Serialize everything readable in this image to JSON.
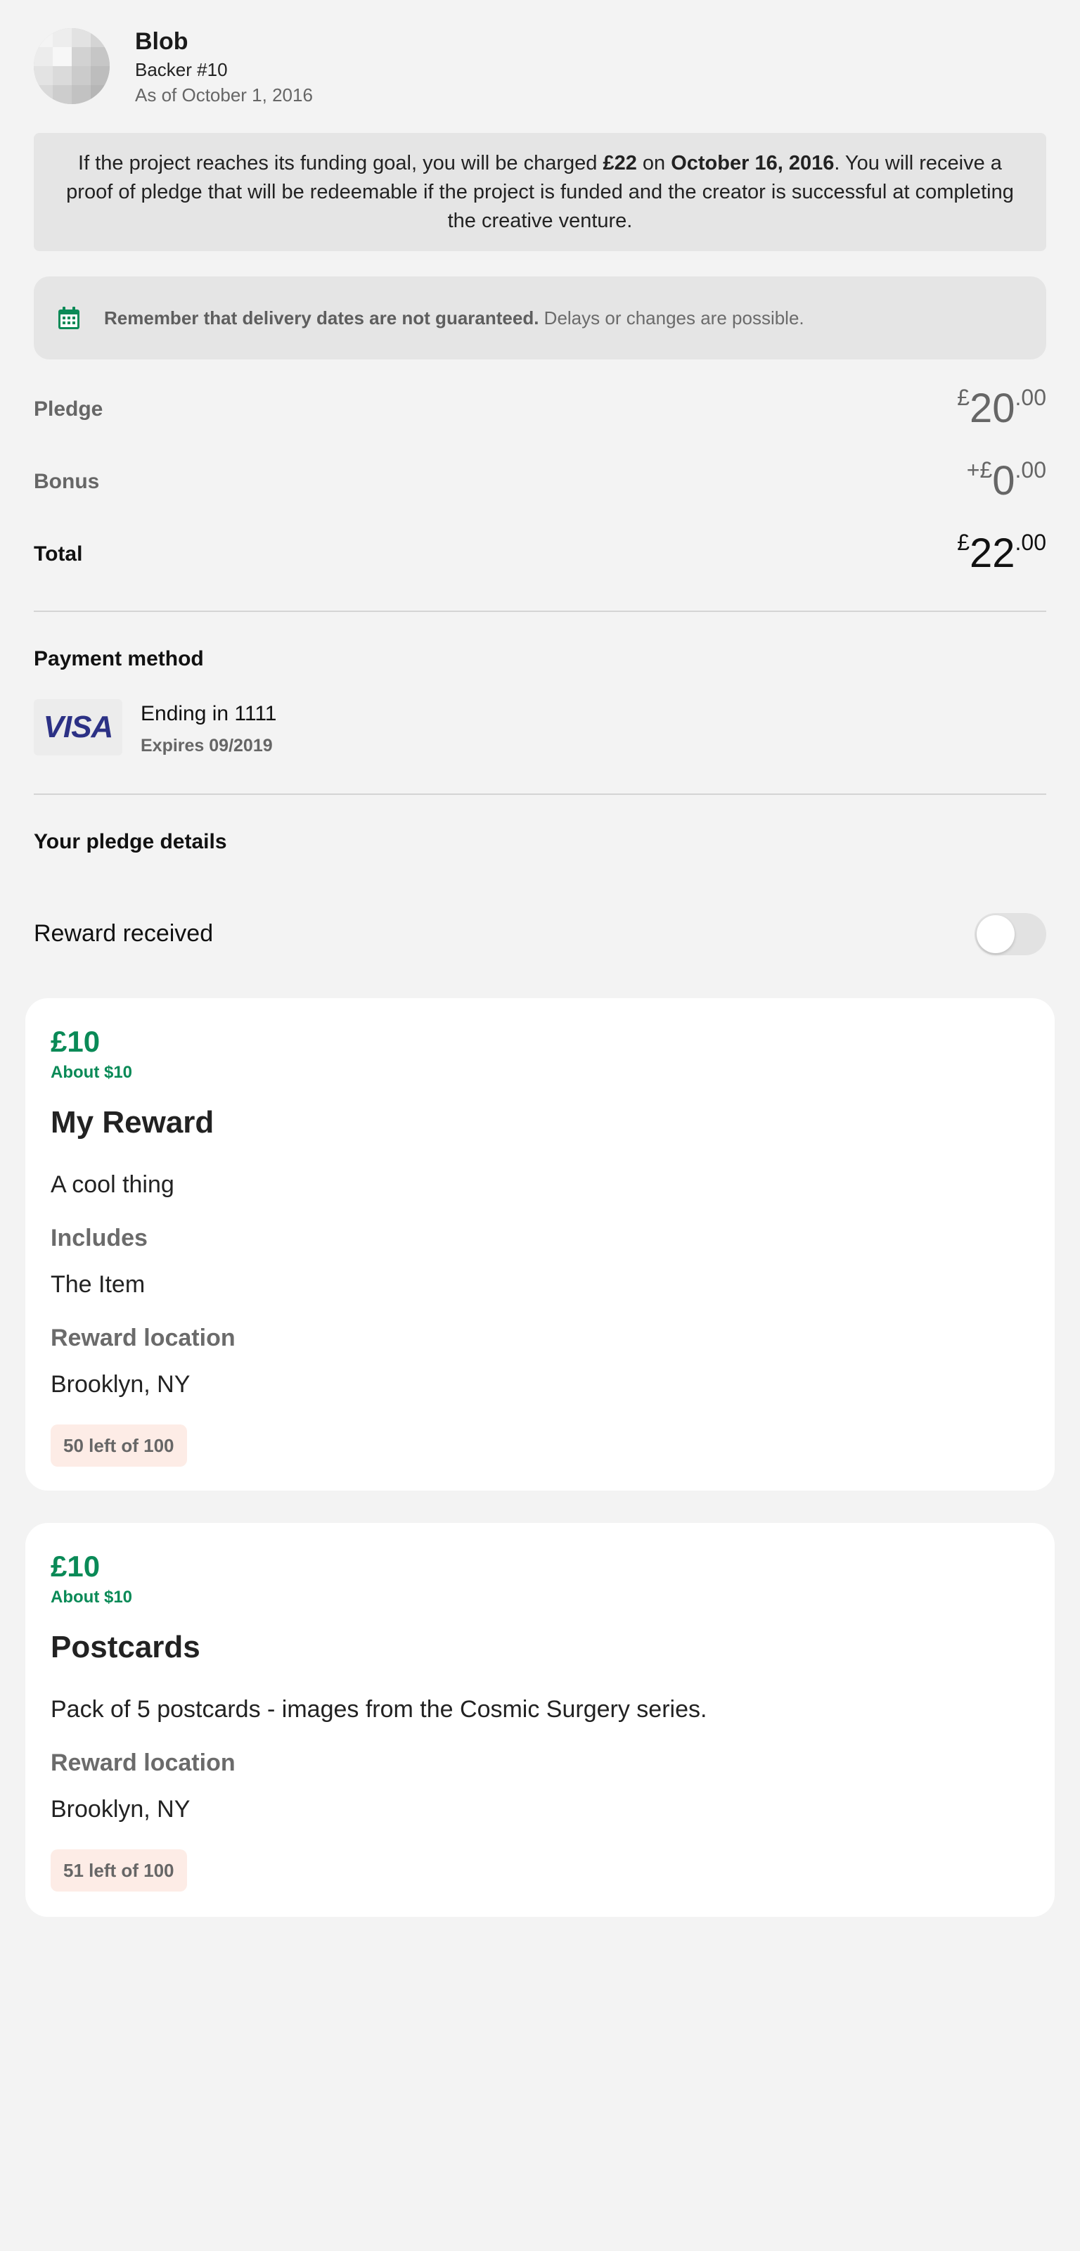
{
  "backer": {
    "name": "Blob",
    "number": "Backer #10",
    "as_of": "As of October 1, 2016"
  },
  "notice": {
    "part1": "If the project reaches its funding goal, you will be charged ",
    "amount": "£22",
    "part2": " on ",
    "date": "October 16, 2016",
    "part3": ". You will receive a proof of pledge that will be redeemable if the project is funded and the creator is successful at completing the creative venture."
  },
  "warning": {
    "bold": "Remember that delivery dates are not guaranteed.",
    "rest": " Delays or changes are possible.",
    "icon": "calendar-icon",
    "icon_color": "#0a8a57"
  },
  "amounts": {
    "pledge": {
      "label": "Pledge",
      "prefix": "£",
      "whole": "20",
      "cents": ".00"
    },
    "bonus": {
      "label": "Bonus",
      "prefix": "+£",
      "whole": "0",
      "cents": ".00"
    },
    "total": {
      "label": "Total",
      "prefix": "£",
      "whole": "22",
      "cents": ".00"
    }
  },
  "payment": {
    "section_title": "Payment method",
    "brand": "VISA",
    "ending": "Ending in 1111",
    "expires": "Expires 09/2019"
  },
  "pledge_details": {
    "section_title": "Your pledge details",
    "reward_received_label": "Reward received",
    "reward_received_on": false
  },
  "rewards": [
    {
      "price": "£10",
      "about": "About $10",
      "title": "My Reward",
      "description": "A cool thing",
      "includes_label": "Includes",
      "includes": "The Item",
      "location_label": "Reward location",
      "location": "Brooklyn, NY",
      "remaining": "50 left of 100"
    },
    {
      "price": "£10",
      "about": "About $10",
      "title": "Postcards",
      "description": "Pack of 5 postcards - images from the Cosmic Surgery series.",
      "location_label": "Reward location",
      "location": "Brooklyn, NY",
      "remaining": "51 left of 100"
    }
  ],
  "colors": {
    "accent_green": "#0a8a57",
    "background": "#f3f3f3",
    "badge_bg": "#fdece6"
  }
}
